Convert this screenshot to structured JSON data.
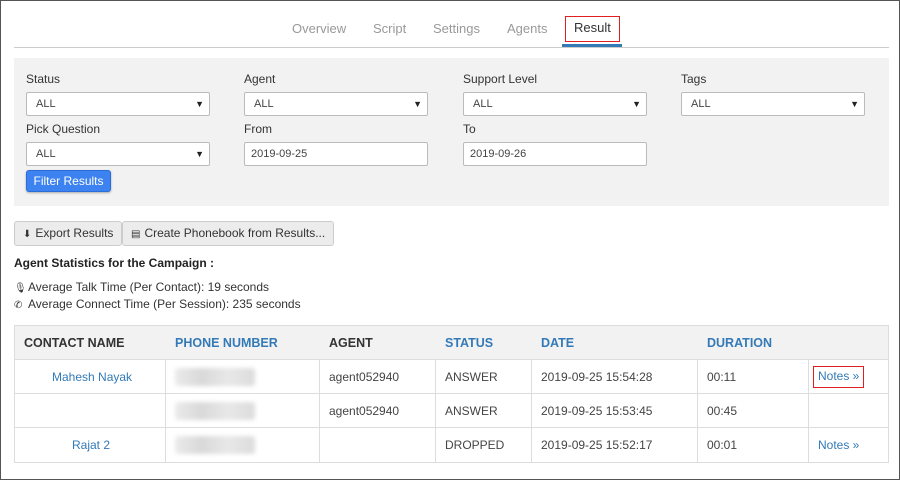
{
  "tabs": [
    {
      "label": "Overview"
    },
    {
      "label": "Script"
    },
    {
      "label": "Settings"
    },
    {
      "label": "Agents"
    },
    {
      "label": "Result",
      "active": true
    }
  ],
  "filters": {
    "status": {
      "label": "Status",
      "value": "ALL"
    },
    "agent": {
      "label": "Agent",
      "value": "ALL"
    },
    "support_level": {
      "label": "Support Level",
      "value": "ALL"
    },
    "tags": {
      "label": "Tags",
      "value": "ALL"
    },
    "pick_question": {
      "label": "Pick Question",
      "value": "ALL"
    },
    "from": {
      "label": "From",
      "value": "2019-09-25"
    },
    "to": {
      "label": "To",
      "value": "2019-09-26"
    },
    "filter_button": "Filter Results"
  },
  "actions": {
    "export": "Export Results",
    "create_phonebook": "Create Phonebook from Results..."
  },
  "stats": {
    "heading": "Agent Statistics for the Campaign :",
    "talk_time": "Average Talk Time (Per Contact): 19 seconds",
    "connect_time": "Average Connect Time (Per Session): 235 seconds"
  },
  "table": {
    "headers": {
      "contact_name": "CONTACT NAME",
      "phone_number": "PHONE NUMBER",
      "agent": "AGENT",
      "status": "STATUS",
      "date": "DATE",
      "duration": "DURATION"
    },
    "rows": [
      {
        "contact_name": "Mahesh Nayak",
        "agent": "agent052940",
        "status": "ANSWER",
        "date": "2019-09-25 15:54:28",
        "duration": "00:11",
        "notes": "Notes »"
      },
      {
        "contact_name": "",
        "agent": "agent052940",
        "status": "ANSWER",
        "date": "2019-09-25 15:53:45",
        "duration": "00:45",
        "notes": ""
      },
      {
        "contact_name": "Rajat 2",
        "agent": "",
        "status": "DROPPED",
        "date": "2019-09-25 15:52:17",
        "duration": "00:01",
        "notes": "Notes »"
      }
    ]
  },
  "colors": {
    "accent": "#337ab7",
    "primary_button": "#3c82f0",
    "highlight_box": "#e02020"
  }
}
